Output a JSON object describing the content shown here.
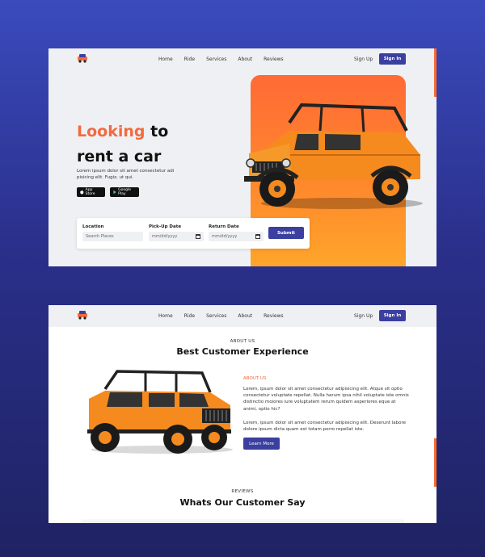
{
  "nav": {
    "links": [
      "Home",
      "Ride",
      "Services",
      "About",
      "Reviews"
    ],
    "sign_up": "Sign Up",
    "sign_in": "Sign In"
  },
  "hero": {
    "title_accent": "Looking",
    "title_rest": " to",
    "title_line2": "rent a car",
    "description": "Lorem ipsum dolor sit amet consectetur adi pisicing elit. Fugiz, ut qui.",
    "app_store": "App Store",
    "google_play": "Google Play",
    "search": {
      "location_label": "Location",
      "location_placeholder": "Search Places",
      "pickup_label": "Pick-Up Date",
      "pickup_value": "mm/dd/yyyy",
      "return_label": "Return Date",
      "return_value": "mm/dd/yyyy",
      "submit": "Submit"
    }
  },
  "about": {
    "eyebrow": "ABOUT US",
    "title": "Best Customer Experience",
    "sub_eyebrow": "ABOUT US",
    "para1": "Lorem, ipsum dolor sit amet consectetur adipisicing elit. Atque sit optio consectetur voluptate repellat. Nulla harum ipsa nihil voluptate iste omnis distinctio moiores iure voluptatem rerum quidem asperiores eque at animi, optio hic?",
    "para2": "Lorem, ipsum dolor sit amet consectetur adipisicing elit. Deserunt labore dolore ipsum dicta quam est totam porro repellat iste.",
    "learn_more": "Learn More"
  },
  "reviews": {
    "eyebrow": "REVIEWS",
    "title": "Whats Our Customer Say"
  },
  "colors": {
    "accent": "#f26a3f",
    "primary_button": "#3b3fa0",
    "background": "#2f3a9e"
  }
}
